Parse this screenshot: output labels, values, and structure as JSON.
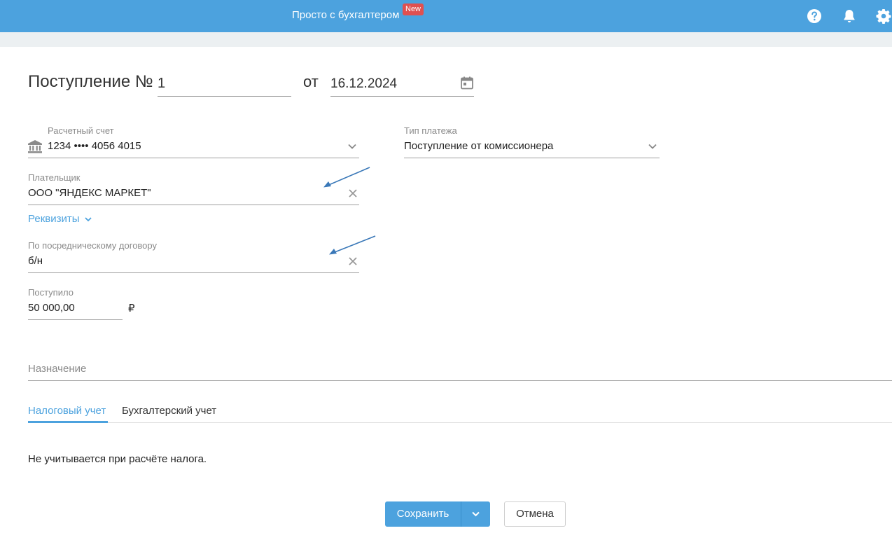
{
  "header": {
    "title": "Просто с бухгалтером",
    "badge": "New",
    "icons": [
      "help-icon",
      "bell-icon",
      "gear-icon"
    ]
  },
  "document": {
    "title": "Поступление №",
    "number": "1",
    "date_prefix": "от",
    "date": "16.12.2024"
  },
  "account": {
    "label": "Расчетный счет",
    "value": "1234 •••• 4056 4015"
  },
  "payment_type": {
    "label": "Тип платежа",
    "value": "Поступление от комиссионера"
  },
  "payer": {
    "label": "Плательщик",
    "value": "ООО \"ЯНДЕКС МАРКЕТ\""
  },
  "details_link": "Реквизиты",
  "contract": {
    "label": "По посредническому договору",
    "value": "б/н"
  },
  "received": {
    "label": "Поступило",
    "value": "50 000,00",
    "currency": "₽"
  },
  "purpose": {
    "placeholder": "Назначение"
  },
  "tabs": [
    {
      "label": "Налоговый учет",
      "active": true
    },
    {
      "label": "Бухгалтерский учет",
      "active": false
    }
  ],
  "tax_note": "Не учитывается при расчёте налога.",
  "buttons": {
    "save": "Сохранить",
    "cancel": "Отмена"
  },
  "colors": {
    "accent": "#4ca2de",
    "badge": "#e05050",
    "annotation_arrow": "#3a78b8"
  }
}
